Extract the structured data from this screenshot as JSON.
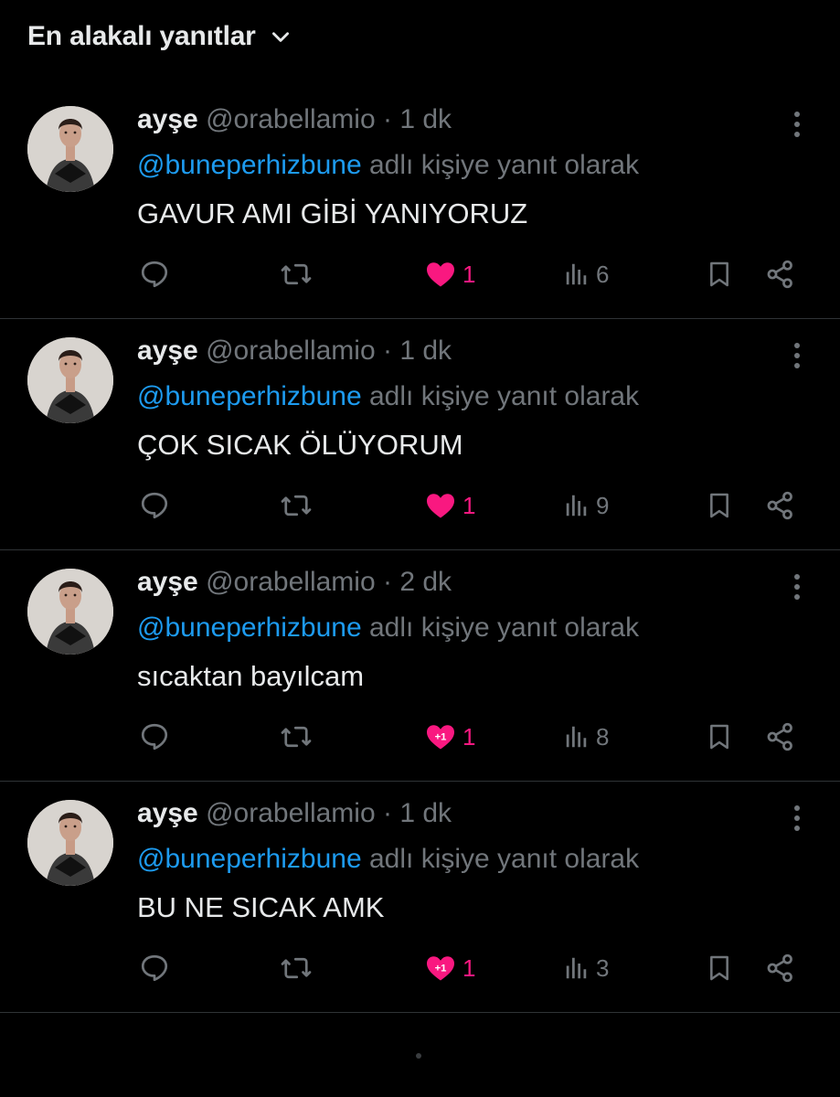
{
  "sort": {
    "label": "En alakalı yanıtlar"
  },
  "colors": {
    "background": "#000000",
    "text": "#e7e9ea",
    "muted": "#71767b",
    "mention": "#1d9bf0",
    "like": "#f91880",
    "divider": "#2f3336"
  },
  "replies": [
    {
      "username": "ayşe",
      "handle": "@orabellamio",
      "separator": "·",
      "time": "1 dk",
      "mention": "@buneperhizbune",
      "reply_to_suffix": "adlı kişiye yanıt olarak",
      "text": "GAVUR AMI GİBİ YANIYORUZ",
      "likes": "1",
      "views": "6",
      "liked": true,
      "like_badge": ""
    },
    {
      "username": "ayşe",
      "handle": "@orabellamio",
      "separator": "·",
      "time": "1 dk",
      "mention": "@buneperhizbune",
      "reply_to_suffix": "adlı kişiye yanıt olarak",
      "text": "ÇOK SICAK ÖLÜYORUM",
      "likes": "1",
      "views": "9",
      "liked": true,
      "like_badge": ""
    },
    {
      "username": "ayşe",
      "handle": "@orabellamio",
      "separator": "·",
      "time": "2 dk",
      "mention": "@buneperhizbune",
      "reply_to_suffix": "adlı kişiye yanıt olarak",
      "text": "sıcaktan bayılcam",
      "likes": "1",
      "views": "8",
      "liked": true,
      "like_badge": "+1"
    },
    {
      "username": "ayşe",
      "handle": "@orabellamio",
      "separator": "·",
      "time": "1 dk",
      "mention": "@buneperhizbune",
      "reply_to_suffix": "adlı kişiye yanıt olarak",
      "text": "BU NE SICAK AMK",
      "likes": "1",
      "views": "3",
      "liked": true,
      "like_badge": "+1"
    }
  ],
  "icons": {
    "sort_chevron": "chevron-down-icon",
    "more": "more-vertical-icon",
    "reply": "reply-bubble-icon",
    "retweet": "repost-icon",
    "like": "heart-icon",
    "views": "views-chart-icon",
    "bookmark": "bookmark-icon",
    "share": "share-icon"
  }
}
